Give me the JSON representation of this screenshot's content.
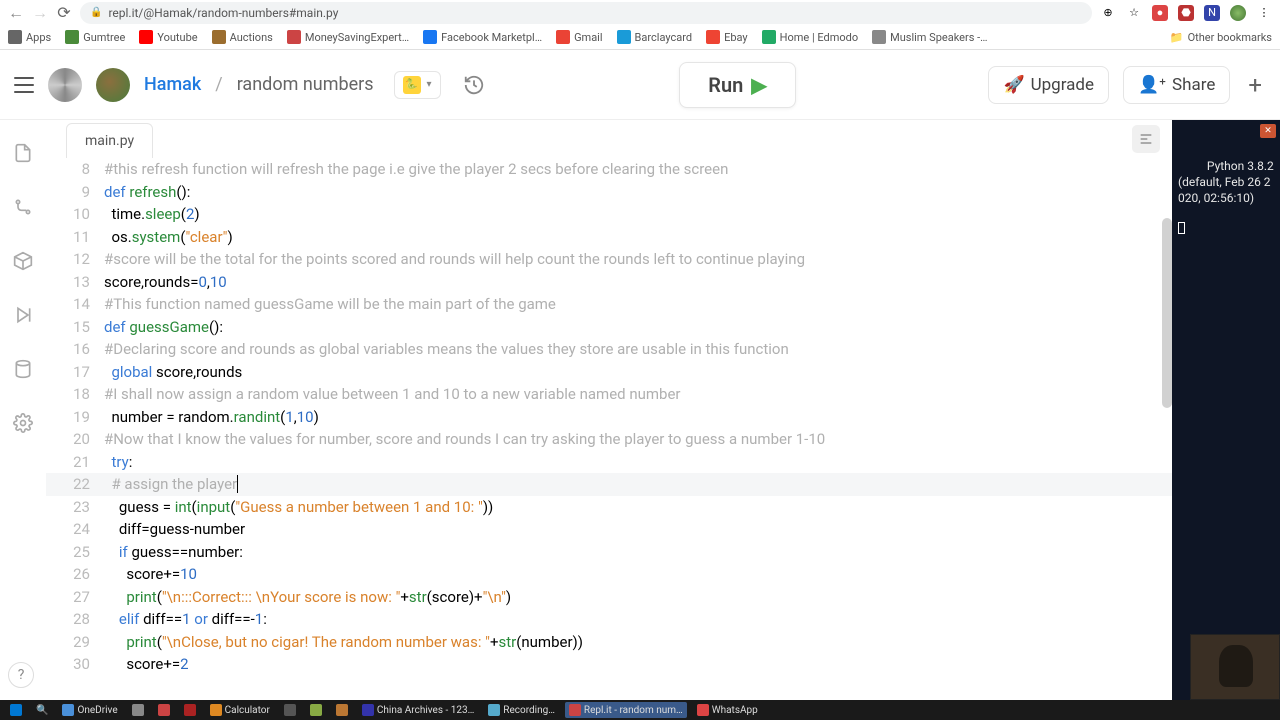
{
  "browser": {
    "url": "repl.it/@Hamak/random-numbers#main.py",
    "bookmarks": [
      {
        "label": "Apps",
        "color": "#666"
      },
      {
        "label": "Gumtree",
        "color": "#4a8b3a"
      },
      {
        "label": "Youtube",
        "color": "#ff0000"
      },
      {
        "label": "Auctions",
        "color": "#9b6d2e"
      },
      {
        "label": "MoneySavingExpert…",
        "color": "#c44"
      },
      {
        "label": "Facebook Marketpl…",
        "color": "#1877f2"
      },
      {
        "label": "Gmail",
        "color": "#ea4335"
      },
      {
        "label": "Barclaycard",
        "color": "#1a9bd8"
      },
      {
        "label": "Ebay",
        "color": "#e43"
      },
      {
        "label": "Home | Edmodo",
        "color": "#2a6"
      },
      {
        "label": "Muslim Speakers -…",
        "color": "#888"
      }
    ],
    "other_bookmarks": "Other bookmarks"
  },
  "header": {
    "user": "Hamak",
    "project": "random numbers",
    "run": "Run",
    "upgrade": "Upgrade",
    "share": "Share"
  },
  "editor": {
    "tab": "main.py",
    "lines": [
      {
        "n": 8,
        "html": "<span class='c'>#this refresh function will refresh the page i.e give the player 2 secs before clearing the screen</span>"
      },
      {
        "n": 9,
        "html": "<span class='k'>def</span> <span class='fn'>refresh</span>():"
      },
      {
        "n": 10,
        "html": "  time.<span class='fn'>sleep</span>(<span class='n'>2</span>)"
      },
      {
        "n": 11,
        "html": "  os.<span class='fn'>system</span>(<span class='s'>\"clear\"</span>)"
      },
      {
        "n": 12,
        "html": "<span class='c'>#score will be the total for the points scored and rounds will help count the rounds left to continue playing</span>"
      },
      {
        "n": 13,
        "html": "score,rounds=<span class='n'>0</span>,<span class='n'>10</span>"
      },
      {
        "n": 14,
        "html": "<span class='c'>#This function named guessGame will be the main part of the game</span>"
      },
      {
        "n": 15,
        "html": "<span class='k'>def</span> <span class='fn'>guessGame</span>():"
      },
      {
        "n": 16,
        "html": "<span class='c'>#Declaring score and rounds as global variables means the values they store are usable in this function</span>"
      },
      {
        "n": 17,
        "html": "  <span class='k'>global</span> score,rounds"
      },
      {
        "n": 18,
        "html": "<span class='c'>#I shall now assign a random value between 1 and 10 to a new variable named number</span>"
      },
      {
        "n": 19,
        "html": "  number = random.<span class='fn'>randint</span>(<span class='n'>1</span>,<span class='n'>10</span>)"
      },
      {
        "n": 20,
        "html": "<span class='c'>#Now that I know the values for number, score and rounds I can try asking the player to guess a number 1-10</span>"
      },
      {
        "n": 21,
        "html": "  <span class='k'>try</span>:"
      },
      {
        "n": 22,
        "html": "  <span class='c'># assign the player</span><span class='cursor'></span>",
        "hl": true
      },
      {
        "n": 23,
        "html": "    guess = <span class='fn'>int</span>(<span class='fn'>input</span>(<span class='s'>\"Guess a number between 1 and 10: \"</span>))"
      },
      {
        "n": 24,
        "html": "    diff=guess-number"
      },
      {
        "n": 25,
        "html": "    <span class='k'>if</span> guess==number:"
      },
      {
        "n": 26,
        "html": "      score+=<span class='n'>10</span>"
      },
      {
        "n": 27,
        "html": "      <span class='fn'>print</span>(<span class='s'>\"\\n:::Correct::: \\nYour score is now: \"</span>+<span class='fn'>str</span>(score)+<span class='s'>\"\\n\"</span>)"
      },
      {
        "n": 28,
        "html": "    <span class='k'>elif</span> diff==<span class='n'>1</span> <span class='k'>or</span> diff==-<span class='n'>1</span>:"
      },
      {
        "n": 29,
        "html": "      <span class='fn'>print</span>(<span class='s'>\"\\nClose, but no cigar! The random number was: \"</span>+<span class='fn'>str</span>(number))"
      },
      {
        "n": 30,
        "html": "      score+=<span class='n'>2</span>"
      }
    ]
  },
  "console": {
    "text": "Python 3.8.2 (default, Feb 26 2020, 02:56:10)"
  },
  "taskbar": {
    "items": [
      {
        "label": "OneDrive",
        "active": false
      },
      {
        "label": "",
        "active": false
      },
      {
        "label": "",
        "active": false
      },
      {
        "label": "",
        "active": false
      },
      {
        "label": "Calculator",
        "active": false
      },
      {
        "label": "",
        "active": false
      },
      {
        "label": "",
        "active": false
      },
      {
        "label": "",
        "active": false
      },
      {
        "label": "China Archives - 123…",
        "active": false
      },
      {
        "label": "Recording…",
        "active": false
      },
      {
        "label": "Repl.it - random num…",
        "active": true
      },
      {
        "label": "WhatsApp",
        "active": false
      }
    ]
  }
}
